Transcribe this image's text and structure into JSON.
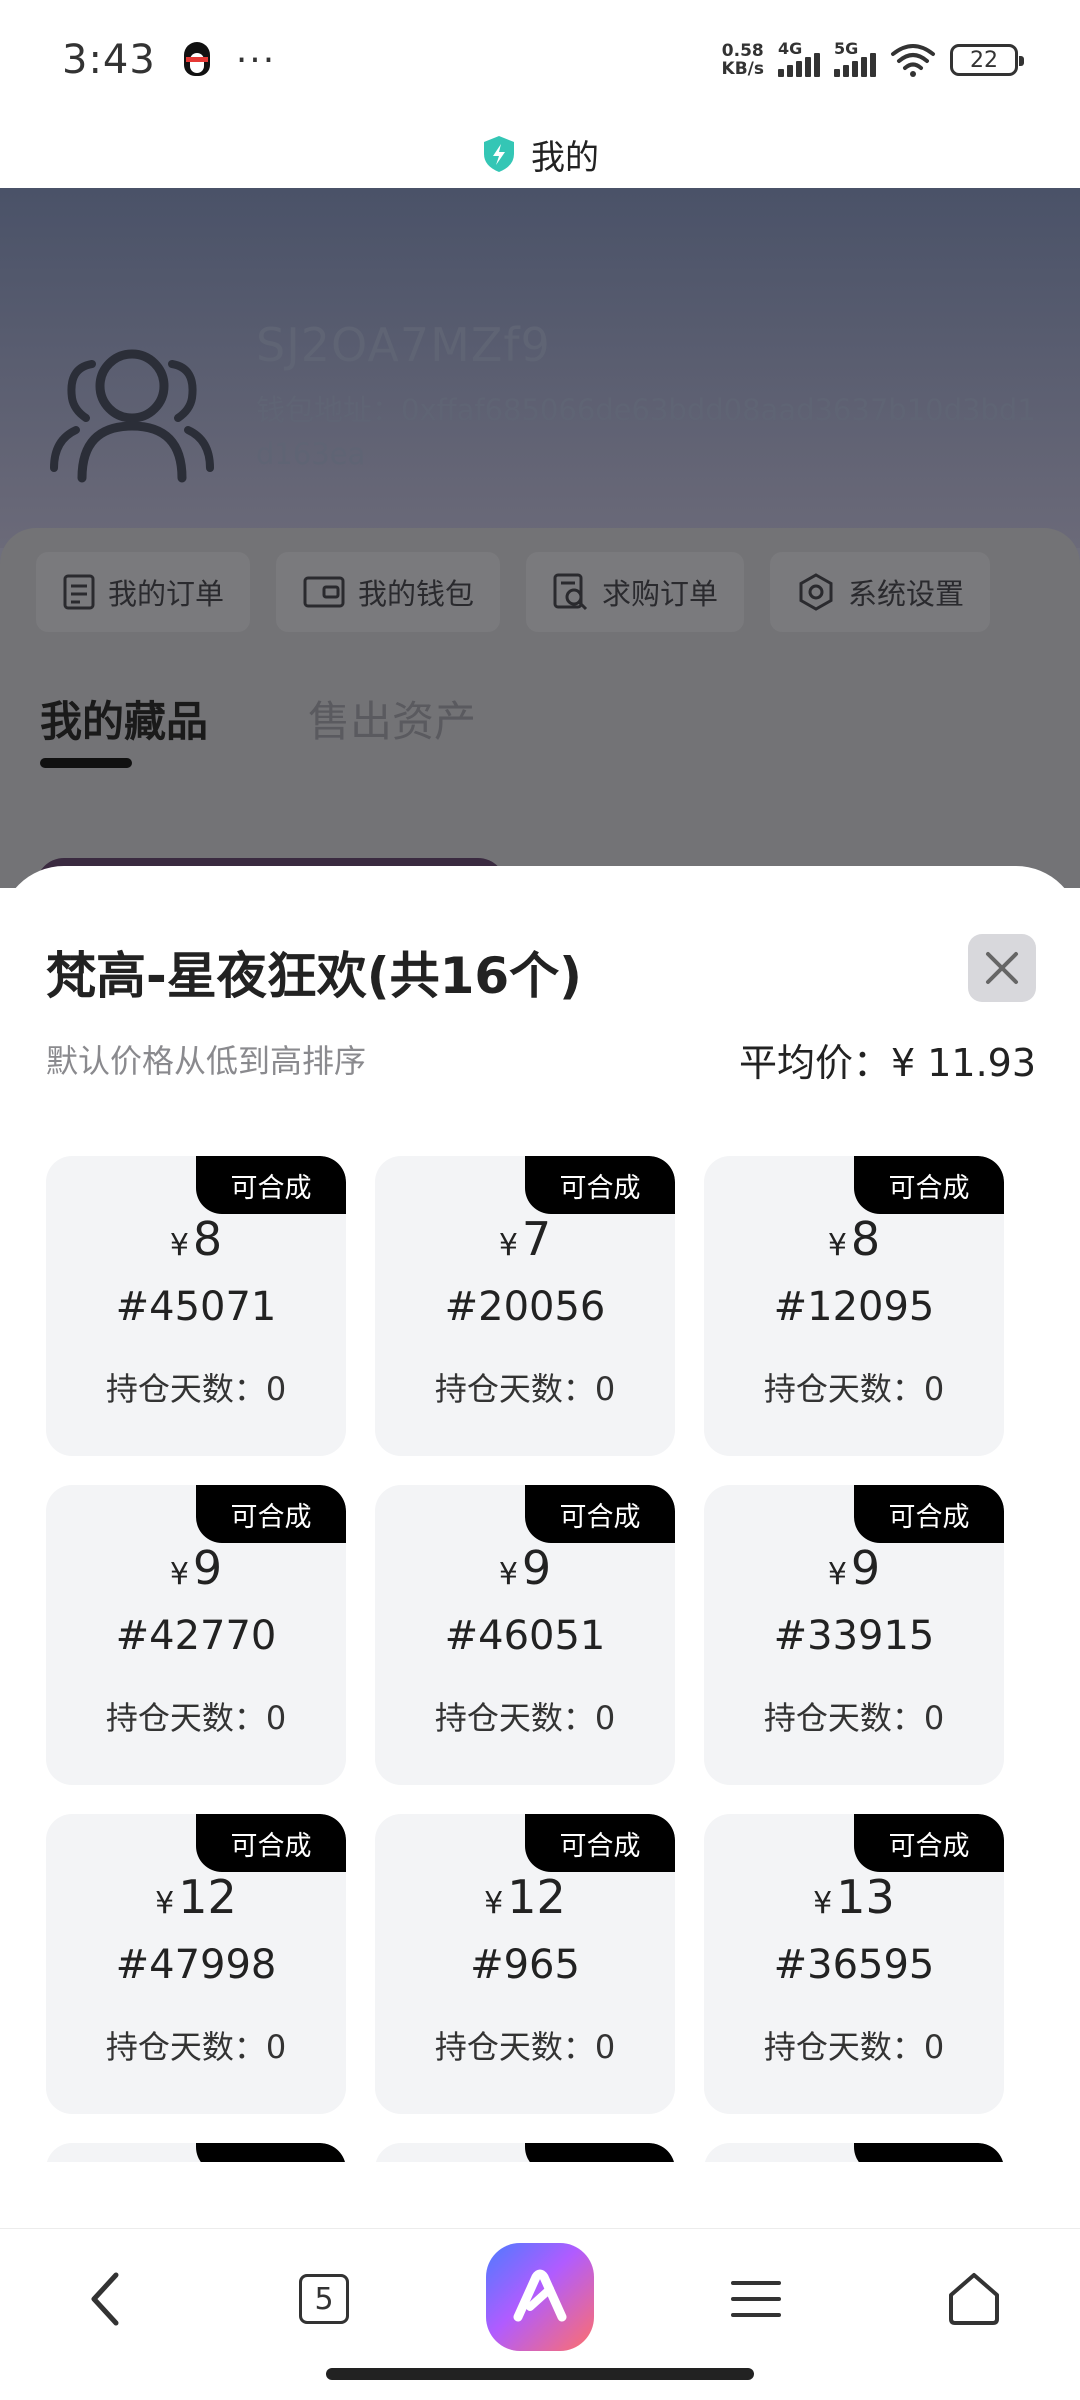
{
  "status_bar": {
    "time": "3:43",
    "more": "···",
    "net_speed_value": "0.58",
    "net_speed_unit": "KB/s",
    "signal1_label": "4G",
    "signal2_label": "5G",
    "battery": "22"
  },
  "header": {
    "title": "我的",
    "accent_color": "#34c6b5"
  },
  "profile": {
    "username": "SJ2OA7MZf9",
    "wallet_address": "钱包地址：0xffaf685066de63bdd08aad3637b10d3bd1d163ea"
  },
  "menu": {
    "items": [
      {
        "label": "我的订单",
        "icon": "order-list-icon"
      },
      {
        "label": "我的钱包",
        "icon": "wallet-icon"
      },
      {
        "label": "求购订单",
        "icon": "purchase-search-icon"
      },
      {
        "label": "系统设置",
        "icon": "settings-icon"
      }
    ]
  },
  "tabs": [
    {
      "label": "我的藏品",
      "active": true
    },
    {
      "label": "售出资产",
      "active": false
    }
  ],
  "sheet": {
    "title": "梵高-星夜狂欢(共16个)",
    "sort_hint": "默认价格从低到高排序",
    "avg_price_label": "平均价：",
    "avg_price_value": "¥ 11.93",
    "currency": "¥",
    "badge_label": "可合成",
    "days_label": "持仓天数：",
    "items": [
      {
        "price": "8",
        "id": "#45071",
        "days": "0"
      },
      {
        "price": "7",
        "id": "#20056",
        "days": "0"
      },
      {
        "price": "8",
        "id": "#12095",
        "days": "0"
      },
      {
        "price": "9",
        "id": "#42770",
        "days": "0"
      },
      {
        "price": "9",
        "id": "#46051",
        "days": "0"
      },
      {
        "price": "9",
        "id": "#33915",
        "days": "0"
      },
      {
        "price": "12",
        "id": "#47998",
        "days": "0"
      },
      {
        "price": "12",
        "id": "#965",
        "days": "0"
      },
      {
        "price": "13",
        "id": "#36595",
        "days": "0"
      }
    ]
  },
  "bottom_nav": {
    "tab_count": "5",
    "items": [
      "back-icon",
      "tabs-icon",
      "ai-assistant-icon",
      "menu-icon",
      "home-icon"
    ]
  }
}
